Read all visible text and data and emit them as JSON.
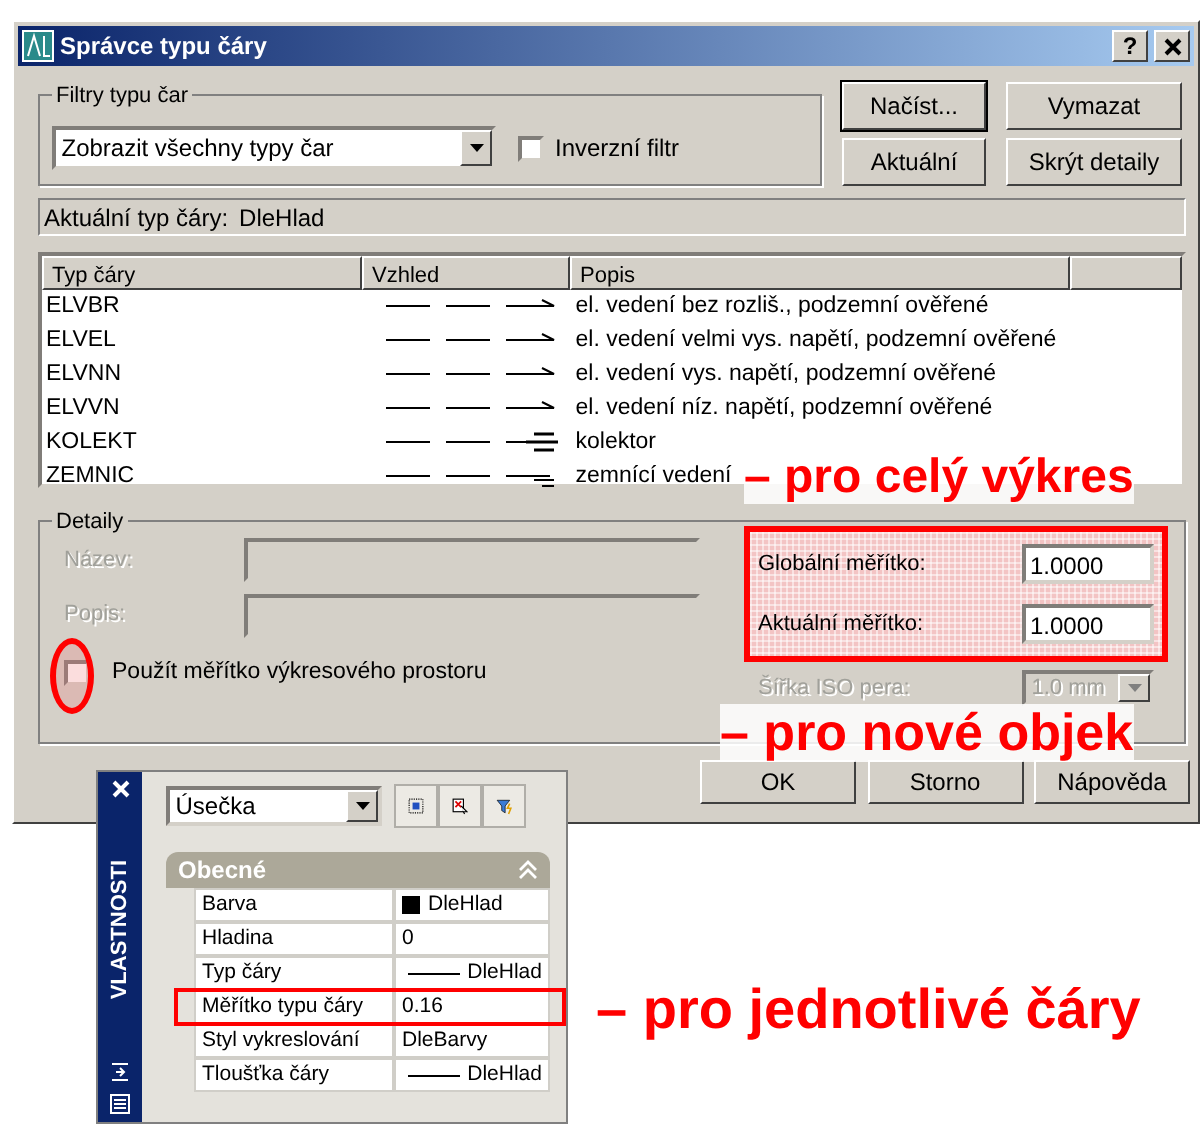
{
  "window": {
    "title": "Správce typu čáry",
    "help_button": "?"
  },
  "filter": {
    "group_label": "Filtry typu čar",
    "dropdown_value": "Zobrazit všechny typy čar",
    "inverse": {
      "label": "Inverzní filtr",
      "checked": false
    }
  },
  "buttons": [
    {
      "label": "Načíst...",
      "default": true
    },
    {
      "label": "Vymazat",
      "default": false
    },
    {
      "label": "Aktuální",
      "default": false
    },
    {
      "label": "Skrýt detaily",
      "default": false
    }
  ],
  "current_linetype": {
    "label": "Aktuální typ čáry:",
    "value": "DleHlad"
  },
  "table": {
    "columns": [
      "Typ čáry",
      "Vzhled",
      "Popis"
    ],
    "rows": [
      {
        "name": "ELVBR",
        "kind": "arrow",
        "description": "el. vedení bez rozliš., podzemní ověřené"
      },
      {
        "name": "ELVEL",
        "kind": "arrow",
        "description": "el. vedení velmi vys. napětí, podzemní ověřené"
      },
      {
        "name": "ELVNN",
        "kind": "arrow",
        "description": "el. vedení vys. napětí, podzemní ověřené"
      },
      {
        "name": "ELVVN",
        "kind": "arrow",
        "description": "el. vedení níz. napětí, podzemní ověřené"
      },
      {
        "name": "KOLEKT",
        "kind": "bars",
        "description": "kolektor"
      },
      {
        "name": "ZEMNIC",
        "kind": "ground",
        "description": "zemnící vedení"
      }
    ]
  },
  "details": {
    "group_label": "Detaily",
    "fields": [
      {
        "label": "Název:",
        "disabled": true
      },
      {
        "label": "Popis:",
        "disabled": true
      }
    ],
    "paper_space_scale": {
      "label": "Použít měřítko výkresového prostoru",
      "checked": false
    },
    "scales": [
      {
        "label": "Globální měřítko:",
        "value": "1.0000"
      },
      {
        "label": "Aktuální měřítko:",
        "value": "1.0000"
      }
    ],
    "pen_width": {
      "label": "Šířka ISO pera:",
      "value": "1.0 mm",
      "disabled": true
    }
  },
  "dialog_buttons": [
    "OK",
    "Storno",
    "Nápověda"
  ],
  "properties_palette": {
    "side_title": "VLASTNOSTI",
    "object_dropdown": "Úsečka",
    "section": "Obecné",
    "rows": [
      {
        "name": "Barva",
        "value": "DleHlad",
        "kind": "color"
      },
      {
        "name": "Hladina",
        "value": "0",
        "kind": "text"
      },
      {
        "name": "Typ čáry",
        "value": "DleHlad",
        "kind": "line"
      },
      {
        "name": "Měřítko typu čáry",
        "value": "0.16",
        "kind": "text",
        "highlighted": true
      },
      {
        "name": "Styl vykreslování",
        "value": "DleBarvy",
        "kind": "text"
      },
      {
        "name": "Tloušťka čáry",
        "value": "DleHlad",
        "kind": "line"
      }
    ]
  },
  "annotations": [
    "– pro celý výkres",
    "– pro nové objek",
    "– pro jednotlivé čáry"
  ]
}
